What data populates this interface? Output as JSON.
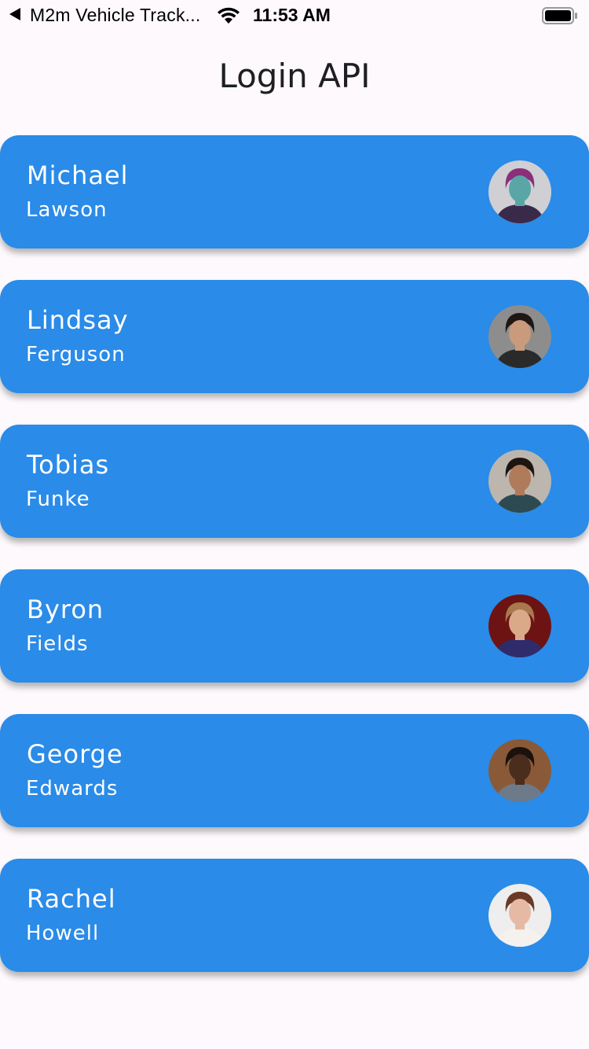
{
  "status_bar": {
    "app_name": "M2m Vehicle Track...",
    "time": "11:53 AM",
    "icons": [
      "back-arrow-icon",
      "wifi-icon",
      "battery-icon"
    ]
  },
  "page": {
    "title": "Login API"
  },
  "users": [
    {
      "first_name": "Michael",
      "last_name": "Lawson",
      "avatar": {
        "bg": "#cfcfd4",
        "skin": "#5aa6a6",
        "hair": "#8a2f7a",
        "shirt": "#3a2a4a"
      }
    },
    {
      "first_name": "Lindsay",
      "last_name": "Ferguson",
      "avatar": {
        "bg": "#8d8d8d",
        "skin": "#c99a7c",
        "hair": "#1e1713",
        "shirt": "#2a2a2a"
      }
    },
    {
      "first_name": "Tobias",
      "last_name": "Funke",
      "avatar": {
        "bg": "#bcb6ae",
        "skin": "#b07b5a",
        "hair": "#1c1511",
        "shirt": "#2d4a52"
      }
    },
    {
      "first_name": "Byron",
      "last_name": "Fields",
      "avatar": {
        "bg": "#6e1313",
        "skin": "#d9a98a",
        "hair": "#a8794d",
        "shirt": "#2e2c6b"
      }
    },
    {
      "first_name": "George",
      "last_name": "Edwards",
      "avatar": {
        "bg": "#8a5a38",
        "skin": "#4a2d1d",
        "hair": "#1b120d",
        "shirt": "#6c7a8a"
      }
    },
    {
      "first_name": "Rachel",
      "last_name": "Howell",
      "avatar": {
        "bg": "#eeeeee",
        "skin": "#e6b9a4",
        "hair": "#6b3a25",
        "shirt": "#f4f1ee"
      }
    }
  ],
  "colors": {
    "card": "#2a8be8",
    "background": "#fdf9fc",
    "title": "#1f1f23"
  }
}
